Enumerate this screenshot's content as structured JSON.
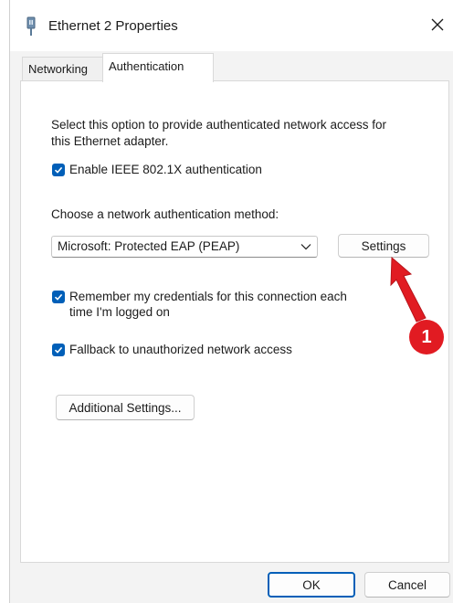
{
  "window": {
    "title": "Ethernet 2 Properties",
    "icon": "network-adapter-icon"
  },
  "tabs": [
    {
      "label": "Networking",
      "active": false
    },
    {
      "label": "Authentication",
      "active": true
    }
  ],
  "auth": {
    "description_line1": "Select this option to provide authenticated network access for",
    "description_line2": "this Ethernet adapter.",
    "enable_8021x_label": "Enable IEEE 802.1X authentication",
    "enable_8021x_checked": true,
    "method_label": "Choose a network authentication method:",
    "method_selected": "Microsoft: Protected EAP (PEAP)",
    "settings_button": "Settings",
    "remember_label_line1": "Remember my credentials for this connection each",
    "remember_label_line2": "time I'm logged on",
    "remember_checked": true,
    "fallback_label": "Fallback to unauthorized network access",
    "fallback_checked": true,
    "additional_settings_button": "Additional Settings..."
  },
  "footer": {
    "ok_label": "OK",
    "cancel_label": "Cancel"
  },
  "annotation": {
    "badge_number": "1",
    "color": "#e11b22"
  },
  "colors": {
    "accent": "#005fb8",
    "panel_bg": "#ffffff",
    "window_bg": "#f3f3f3"
  }
}
